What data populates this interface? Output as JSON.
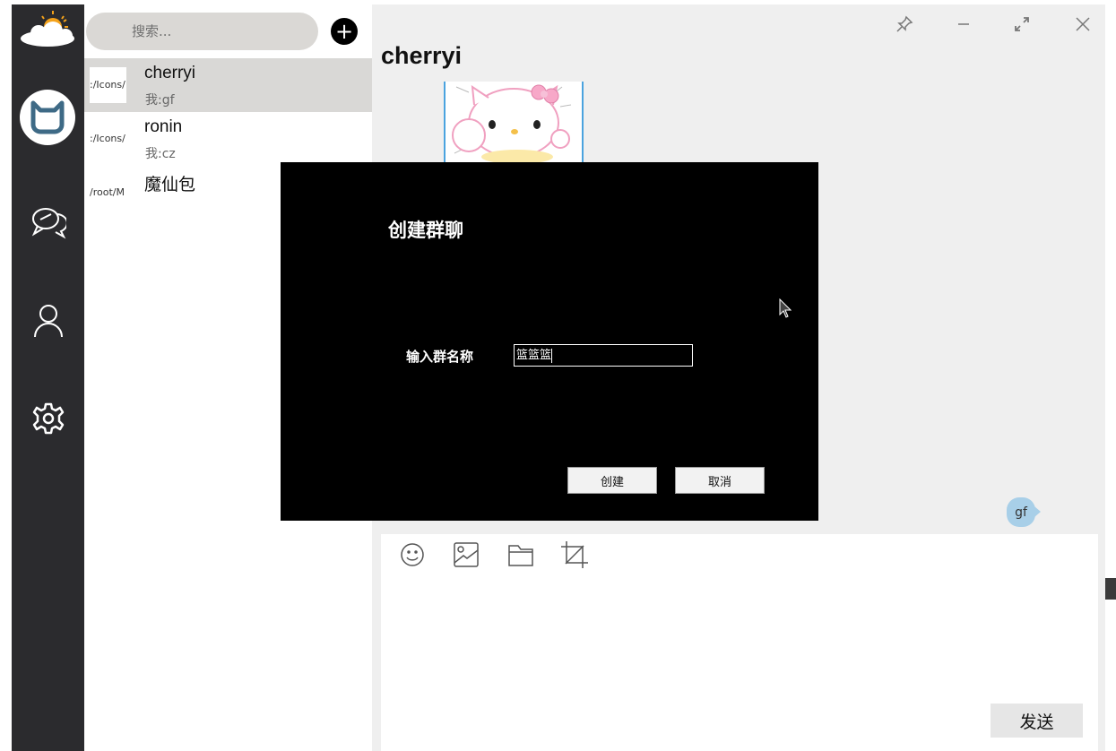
{
  "search": {
    "placeholder": "搜索..."
  },
  "add_button": {
    "label": "+"
  },
  "contacts": [
    {
      "avatar_text": ":/Icons/",
      "name": "cherryi",
      "preview": "我:gf"
    },
    {
      "avatar_text": ":/Icons/",
      "name": "ronin",
      "preview": "我:cz"
    },
    {
      "avatar_text": "/root/M",
      "name": "魔仙包",
      "preview": ""
    }
  ],
  "chat": {
    "title": "cherryi",
    "messages": [
      {
        "text": "gf"
      }
    ],
    "send_label": "发送"
  },
  "dialog": {
    "title": "创建群聊",
    "name_label": "输入群名称",
    "name_value": "篮篮篮",
    "create_label": "创建",
    "cancel_label": "取消"
  },
  "colors": {
    "sidebar_bg": "#2b2b2e",
    "selected_row": "#d9d8d6",
    "bubble": "#a8cfe8",
    "dialog_bg": "#000000"
  },
  "icons": {
    "sidebar": [
      "app-logo-icon",
      "chat-icon",
      "contacts-icon",
      "settings-icon"
    ],
    "toolbar": [
      "emoji-icon",
      "image-icon",
      "folder-icon",
      "crop-icon"
    ],
    "window": [
      "pin-icon",
      "minimize-icon",
      "maximize-icon",
      "close-icon"
    ]
  }
}
